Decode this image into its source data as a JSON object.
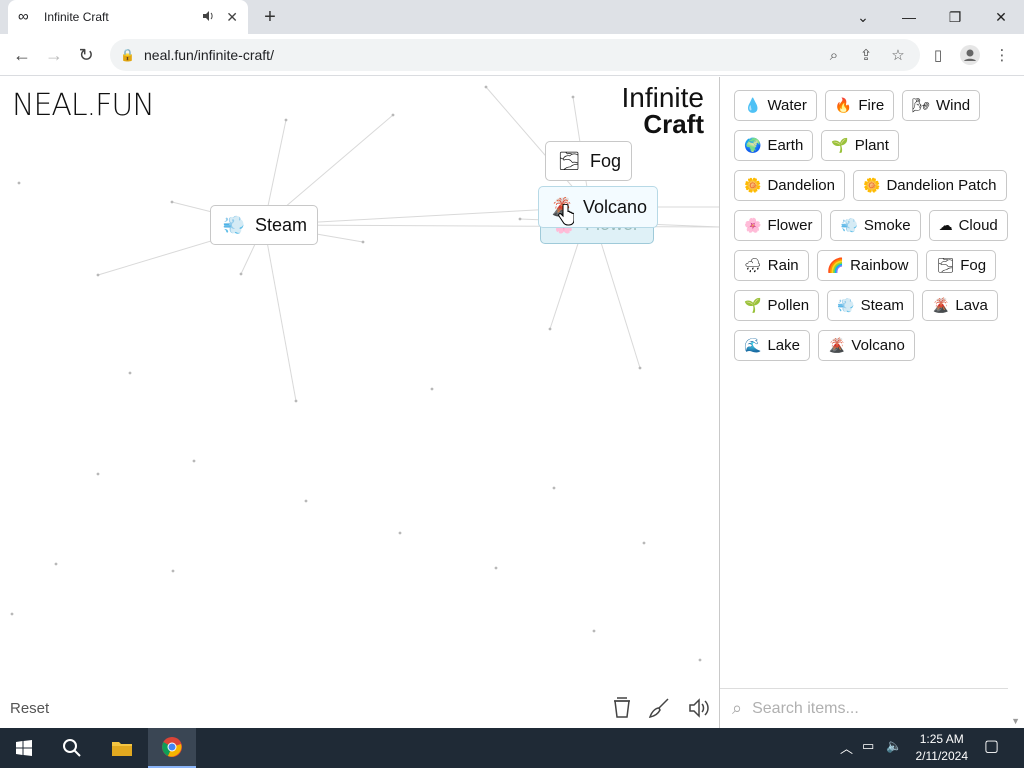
{
  "browser": {
    "tab_title": "Infinite Craft",
    "url": "neal.fun/infinite-craft/",
    "window_controls": [
      "chevron-down",
      "minimize",
      "restore",
      "close"
    ]
  },
  "page": {
    "logo": "NEAL.FUN",
    "brand_line1": "Infinite",
    "brand_line2": "Craft",
    "reset_label": "Reset",
    "search_placeholder": "Search items..."
  },
  "canvas_instances": [
    {
      "emoji": "💨",
      "label": "Steam"
    },
    {
      "emoji": "🌫",
      "label": "Fog"
    },
    {
      "emoji": "🌸",
      "label": "Flower"
    },
    {
      "emoji": "🌋",
      "label": "Volcano"
    }
  ],
  "sidebar_items": [
    {
      "emoji": "💧",
      "label": "Water"
    },
    {
      "emoji": "🔥",
      "label": "Fire"
    },
    {
      "emoji": "🌬",
      "label": "Wind"
    },
    {
      "emoji": "🌍",
      "label": "Earth"
    },
    {
      "emoji": "🌱",
      "label": "Plant"
    },
    {
      "emoji": "🌼",
      "label": "Dandelion"
    },
    {
      "emoji": "🌼",
      "label": "Dandelion Patch"
    },
    {
      "emoji": "🌸",
      "label": "Flower"
    },
    {
      "emoji": "💨",
      "label": "Smoke"
    },
    {
      "emoji": "☁",
      "label": "Cloud"
    },
    {
      "emoji": "🌧",
      "label": "Rain"
    },
    {
      "emoji": "🌈",
      "label": "Rainbow"
    },
    {
      "emoji": "🌫",
      "label": "Fog"
    },
    {
      "emoji": "🌱",
      "label": "Pollen"
    },
    {
      "emoji": "💨",
      "label": "Steam"
    },
    {
      "emoji": "🌋",
      "label": "Lava"
    },
    {
      "emoji": "🌊",
      "label": "Lake"
    },
    {
      "emoji": "🌋",
      "label": "Volcano"
    }
  ],
  "taskbar": {
    "time": "1:25 AM",
    "date": "2/11/2024"
  }
}
